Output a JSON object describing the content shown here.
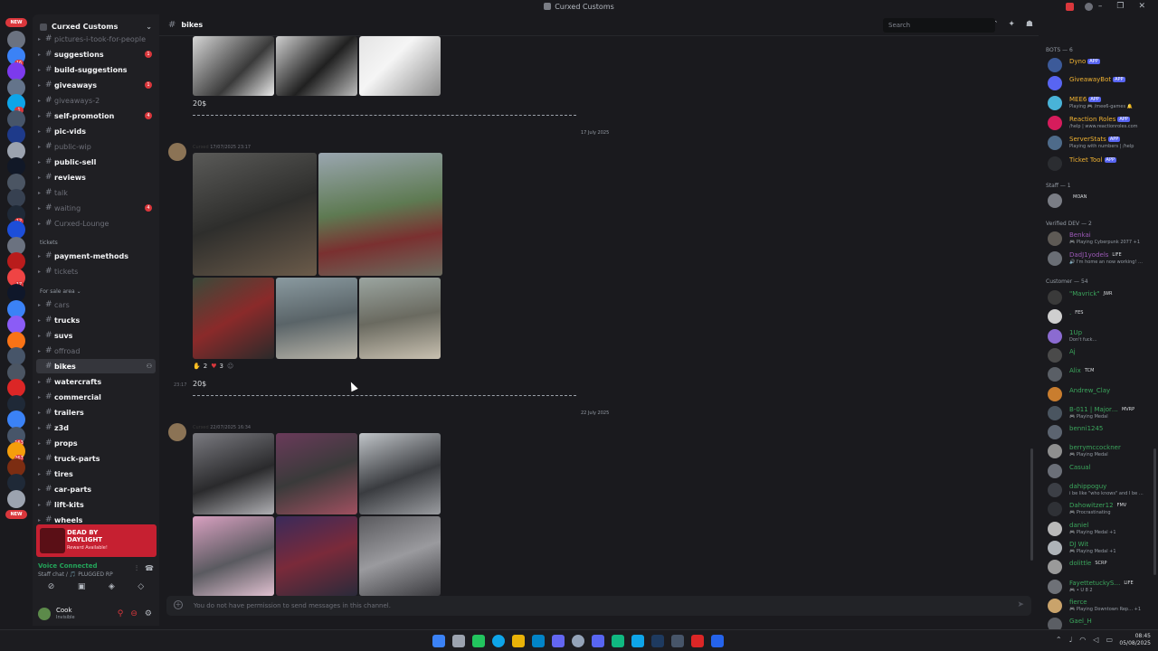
{
  "window": {
    "title": "Curxed Customs",
    "controls": [
      "–",
      "❐",
      "✕"
    ]
  },
  "rail": {
    "new_label": "NEW",
    "bottom_new_label": "NEW",
    "badges": [
      "",
      "16",
      "",
      "",
      "1",
      "",
      "",
      "",
      "",
      "",
      "",
      "12",
      "",
      "",
      "",
      "17",
      "",
      "",
      "",
      "",
      "",
      "",
      "",
      "",
      "",
      "163",
      "267",
      "",
      "",
      ""
    ]
  },
  "server": {
    "name": "Curxed Customs"
  },
  "channels": [
    {
      "name": "pictures-i-took-for-people",
      "state": "muted"
    },
    {
      "name": "suggestions",
      "state": "unread",
      "badge": "1"
    },
    {
      "name": "build-suggestions",
      "state": "unread"
    },
    {
      "name": "giveaways",
      "state": "unread",
      "badge": "1"
    },
    {
      "name": "giveaways-2",
      "state": "muted"
    },
    {
      "name": "self-promotion",
      "state": "unread",
      "badge": "4"
    },
    {
      "name": "pic-vids",
      "state": "unread"
    },
    {
      "name": "public-wip",
      "state": "muted"
    },
    {
      "name": "public-sell",
      "state": "unread"
    },
    {
      "name": "reviews",
      "state": "unread"
    },
    {
      "name": "talk",
      "state": "muted"
    },
    {
      "name": "waiting",
      "state": "muted",
      "badge": "4"
    },
    {
      "name": "Curxed-Lounge",
      "state": "muted"
    }
  ],
  "category_tickets": "tickets",
  "tickets_channels": [
    {
      "name": "payment-methods",
      "state": "unread"
    },
    {
      "name": "tickets",
      "state": "muted"
    }
  ],
  "category_sale": "For sale area",
  "sale_channels": [
    {
      "name": "cars",
      "state": "muted"
    },
    {
      "name": "trucks",
      "state": "unread"
    },
    {
      "name": "suvs",
      "state": "unread"
    },
    {
      "name": "offroad",
      "state": "muted"
    },
    {
      "name": "bikes",
      "state": "active"
    },
    {
      "name": "watercrafts",
      "state": "unread"
    },
    {
      "name": "commercial",
      "state": "unread"
    },
    {
      "name": "trailers",
      "state": "unread"
    },
    {
      "name": "z3d",
      "state": "unread"
    },
    {
      "name": "props",
      "state": "unread"
    },
    {
      "name": "truck-parts",
      "state": "unread"
    },
    {
      "name": "tires",
      "state": "unread"
    },
    {
      "name": "car-parts",
      "state": "unread"
    },
    {
      "name": "lift-kits",
      "state": "unread"
    },
    {
      "name": "wheels",
      "state": "unread"
    }
  ],
  "promo": {
    "title_line1": "DEAD BY",
    "title_line2": "DAYLIGHT",
    "subtitle": "Reward Available!"
  },
  "voice": {
    "status": "Voice Connected",
    "channel": "Staff chat / 🎵 PLUGGED RP"
  },
  "user": {
    "name": "Cook",
    "status": "Invisible"
  },
  "header": {
    "channel": "bikes"
  },
  "search": {
    "placeholder": "Search"
  },
  "messages": [
    {
      "price": "20$"
    },
    {
      "date": "17 July 2025",
      "author": "Curxed",
      "time": "17/07/2025 23:17",
      "reactions": [
        {
          "emoji": "✋",
          "count": "2"
        },
        {
          "emoji": "♥",
          "count": "3"
        }
      ],
      "left_time": "23:17",
      "price": "20$"
    },
    {
      "date": "22 July 2025",
      "author": "Curxed",
      "time": "22/07/2025 16:34"
    }
  ],
  "composer": {
    "placeholder": "You do not have permission to send messages in this channel."
  },
  "members": {
    "bots_header": "BOTS — 6",
    "bots": [
      {
        "name": "Dyno",
        "tag": "APP",
        "color": "#f0b232",
        "av": "#3c5a99",
        "status": ""
      },
      {
        "name": "GiveawayBot",
        "tag": "APP",
        "color": "#f0b232",
        "av": "#5865f2",
        "status": ""
      },
      {
        "name": "MEE6",
        "tag": "APP",
        "color": "#f0b232",
        "av": "#49b3d8",
        "status": "Playing 🎮 /mee6-games 🔔"
      },
      {
        "name": "Reaction Roles",
        "tag": "APP",
        "color": "#f0b232",
        "av": "#d61c5c",
        "status": "/help | www.reactionroles.com"
      },
      {
        "name": "ServerStats",
        "tag": "APP",
        "color": "#f0b232",
        "av": "#4e6b8a",
        "status": "Playing with numbers | /help"
      },
      {
        "name": "Ticket Tool",
        "tag": "APP",
        "color": "#f0b232",
        "av": "#2b2d31",
        "status": ""
      }
    ],
    "staff_header": "Staff — 1",
    "staff": [
      {
        "name": "",
        "tag": "MOAN",
        "color": "#a5111b",
        "av": "#7a7d85",
        "status": ""
      }
    ],
    "dev_header": "Verified DEV — 2",
    "devs": [
      {
        "name": "Benkai",
        "tag": "",
        "color": "#9b59b6",
        "av": "#5e5a55",
        "status": "🎮 Playing Cyberpunk 2077 +1"
      },
      {
        "name": "DadJ1yodels",
        "tag": "LIFE",
        "color": "#9b59b6",
        "av": "#6a6e75",
        "status": "🔊 I'm home an now working! …"
      }
    ],
    "cust_header": "Customer — 54",
    "customers": [
      {
        "name": "\"Mavrick\"",
        "tag": "JWR",
        "color": "#3ba55c",
        "av": "#3a3a3a",
        "status": ""
      },
      {
        "name": ".",
        "tag": "FES",
        "color": "#3ba55c",
        "av": "#cfcfcf",
        "status": ""
      },
      {
        "name": "1Up",
        "tag": "",
        "color": "#3ba55c",
        "av": "#8b6bd1",
        "status": "Don't fuck…"
      },
      {
        "name": "Aj",
        "tag": "",
        "color": "#3ba55c",
        "av": "#4a4a4a",
        "status": ""
      },
      {
        "name": "Alix",
        "tag": "TCM",
        "color": "#3ba55c",
        "av": "#5a5f66",
        "status": ""
      },
      {
        "name": "Andrew_Clay",
        "tag": "",
        "color": "#3ba55c",
        "av": "#c97d2e",
        "status": ""
      },
      {
        "name": "B-011 | Major…",
        "tag": "MVRP",
        "color": "#3ba55c",
        "av": "#4a5560",
        "status": "🎮 Playing Medal"
      },
      {
        "name": "benni1245",
        "tag": "",
        "color": "#3ba55c",
        "av": "#5c6470",
        "status": ""
      },
      {
        "name": "berrymccockner",
        "tag": "",
        "color": "#3ba55c",
        "av": "#8f8f8f",
        "status": "🎮 Playing Medal"
      },
      {
        "name": "Casual",
        "tag": "",
        "color": "#3ba55c",
        "av": "#6b6f78",
        "status": ""
      },
      {
        "name": "dahippoguy",
        "tag": "",
        "color": "#3ba55c",
        "av": "#3c3f46",
        "status": "i be like \"who knows\" and I be …"
      },
      {
        "name": "Dahowitzer12",
        "tag": "FMV",
        "color": "#3ba55c",
        "av": "#2f3136",
        "status": "🎮 Procrastinating"
      },
      {
        "name": "daniel",
        "tag": "",
        "color": "#3ba55c",
        "av": "#b9b9b9",
        "status": "🎮 Playing Medal +1"
      },
      {
        "name": "DJ Wit",
        "tag": "",
        "color": "#3ba55c",
        "av": "#aeb3b8",
        "status": "🎮 Playing Medal +1"
      },
      {
        "name": "dolittle",
        "tag": "SCRP",
        "color": "#3ba55c",
        "av": "#9a9a9a",
        "status": ""
      },
      {
        "name": "FayettetuckyS…",
        "tag": "LIFE",
        "color": "#3ba55c",
        "av": "#6e7177",
        "status": "🎮 • U 8 2"
      },
      {
        "name": "fierce",
        "tag": "",
        "color": "#3ba55c",
        "av": "#c9a36b",
        "status": "🎮 Playing Downtown Rep… +1"
      },
      {
        "name": "Gael_H",
        "tag": "",
        "color": "#3ba55c",
        "av": "#5b5e64",
        "status": ""
      }
    ]
  },
  "taskbar": {
    "time": "08:45",
    "date": "05/08/2025"
  },
  "colors": {
    "accent": "#5865f2",
    "danger": "#da373c",
    "online": "#23a55a"
  }
}
